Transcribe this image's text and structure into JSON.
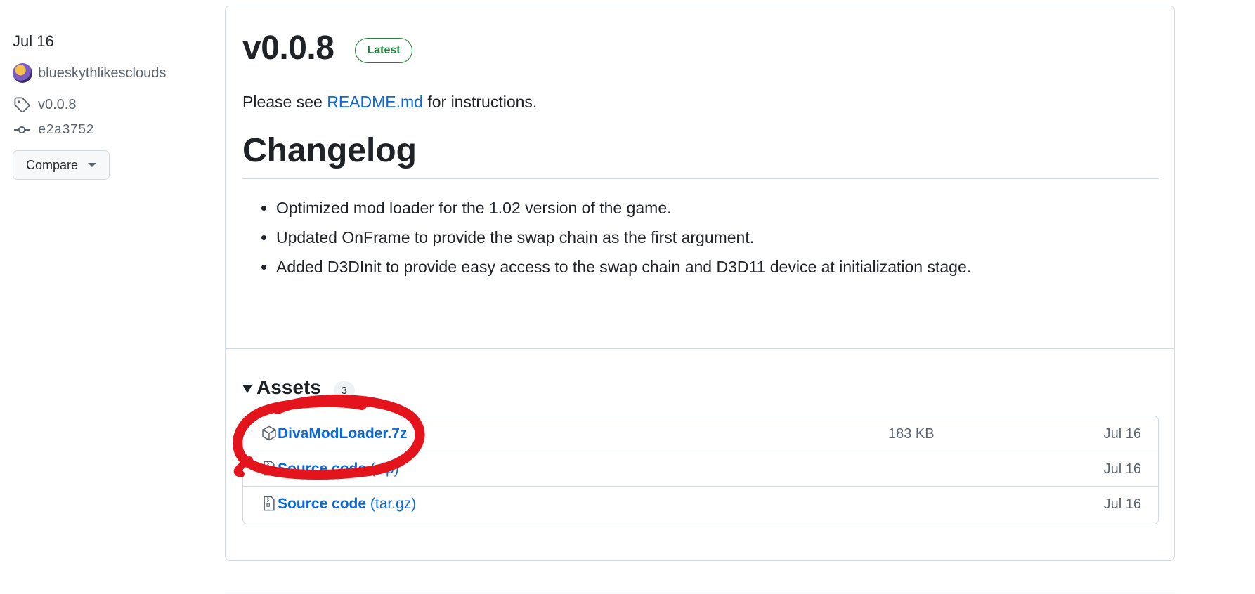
{
  "sidebar": {
    "date": "Jul 16",
    "author": "blueskythlikesclouds",
    "tag": "v0.0.8",
    "commit": "e2a3752",
    "compare_label": "Compare"
  },
  "release": {
    "title": "v0.0.8",
    "badge": "Latest",
    "intro_before": "Please see ",
    "intro_link": "README.md",
    "intro_after": " for instructions.",
    "changelog_heading": "Changelog",
    "changes": [
      "Optimized mod loader for the 1.02 version of the game.",
      "Updated OnFrame to provide the swap chain as the first argument.",
      "Added D3DInit to provide easy access to the swap chain and D3D11 device at initialization stage."
    ]
  },
  "assets": {
    "title": "Assets",
    "count": "3",
    "items": [
      {
        "name": "DivaModLoader.7z",
        "ext": "",
        "size": "183 KB",
        "date": "Jul 16",
        "icon": "package-icon"
      },
      {
        "name": "Source code",
        "ext": "(zip)",
        "size": "",
        "date": "Jul 16",
        "icon": "file-zip-icon"
      },
      {
        "name": "Source code",
        "ext": "(tar.gz)",
        "size": "",
        "date": "Jul 16",
        "icon": "file-zip-icon"
      }
    ]
  },
  "colors": {
    "link": "#0969da",
    "badge_green": "#1a7f37",
    "annotation_red": "#e3141b",
    "border": "#d1d9e0"
  }
}
